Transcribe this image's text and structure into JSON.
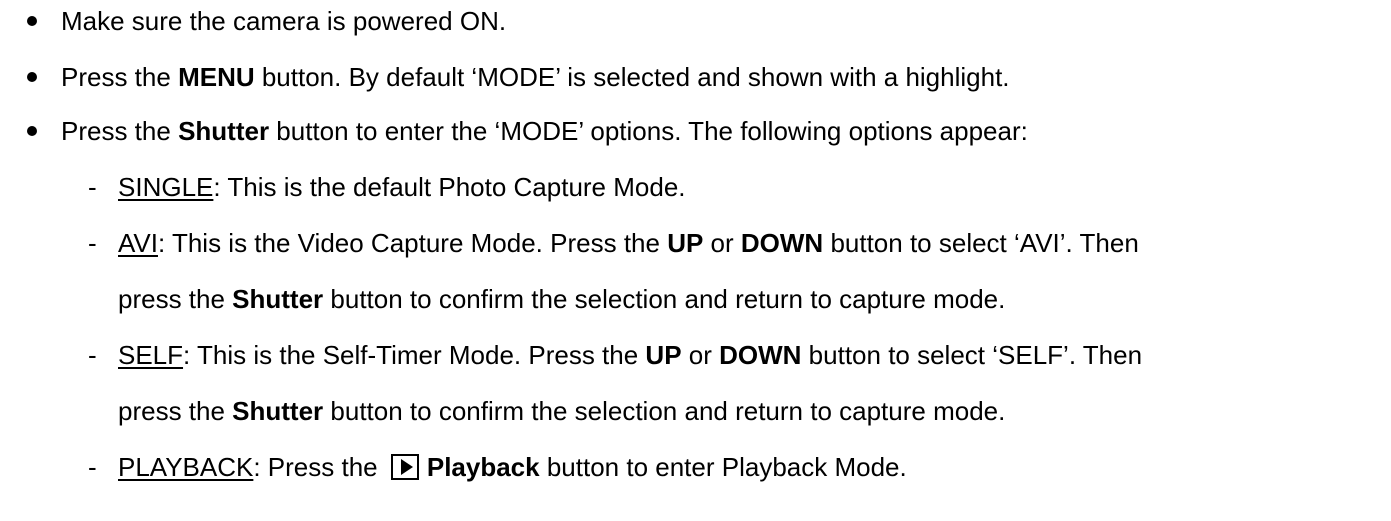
{
  "bullets": [
    {
      "text": "Make sure the camera is powered ON."
    },
    {
      "pre": "Press the ",
      "bold": "MENU",
      "post": " button. By default ‘MODE’ is selected and shown with a highlight."
    },
    {
      "pre": "Press the ",
      "bold": "Shutter",
      "post": " button to enter the ‘MODE’ options. The following options appear:"
    }
  ],
  "options": [
    {
      "term": "SINGLE",
      "desc": ": This is the default Photo Capture Mode."
    },
    {
      "term": "AVI",
      "l1_a": ": This is the Video Capture Mode. Press the ",
      "l1_b": "UP",
      "l1_c": " or ",
      "l1_d": "DOWN",
      "l1_e": " button to select ‘AVI’. Then",
      "l2_a": "press the ",
      "l2_b": "Shutter",
      "l2_c": " button to confirm the selection and return to capture mode."
    },
    {
      "term": "SELF",
      "l1_a": ": This is the Self-Timer Mode. Press the ",
      "l1_b": "UP",
      "l1_c": " or ",
      "l1_d": "DOWN",
      "l1_e": " button to select ‘SELF’. Then",
      "l2_a": "press the ",
      "l2_b": "Shutter",
      "l2_c": " button to confirm the selection and return to capture mode."
    },
    {
      "term": "PLAYBACK",
      "a": ": Press the ",
      "icon": "play-icon",
      "bold": "Playback",
      "b": " button to enter Playback Mode."
    }
  ],
  "dash_char": "-"
}
